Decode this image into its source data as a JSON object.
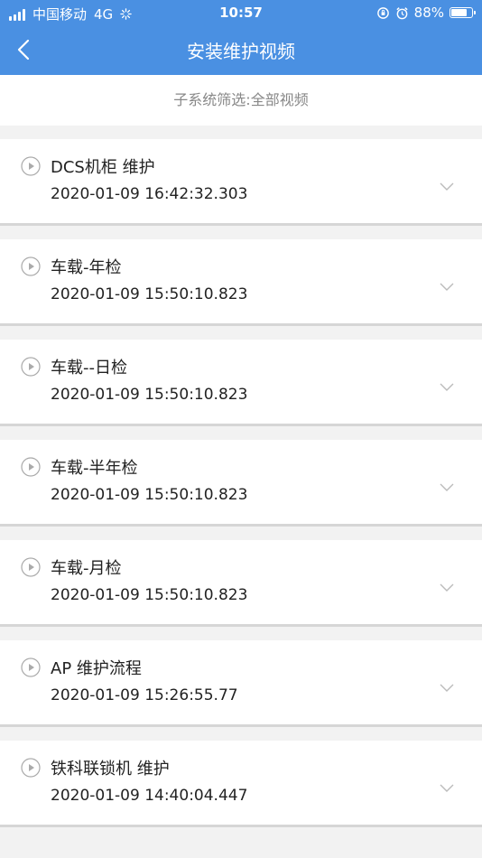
{
  "status": {
    "carrier": "中国移动",
    "network": "4G",
    "time": "10:57",
    "battery": "88%",
    "battery_level": 0.88
  },
  "header": {
    "title": "安装维护视频"
  },
  "filter": {
    "label": "子系统筛选:全部视频"
  },
  "videos": [
    {
      "name": "DCS机柜 维护",
      "date": "2020-01-09 16:42:32.303"
    },
    {
      "name": "车载-年检",
      "date": "2020-01-09 15:50:10.823"
    },
    {
      "name": "车载--日检",
      "date": "2020-01-09 15:50:10.823"
    },
    {
      "name": "车载-半年检",
      "date": "2020-01-09 15:50:10.823"
    },
    {
      "name": "车载-月检",
      "date": "2020-01-09 15:50:10.823"
    },
    {
      "name": "AP 维护流程",
      "date": "2020-01-09 15:26:55.77"
    },
    {
      "name": "铁科联锁机 维护",
      "date": "2020-01-09 14:40:04.447"
    }
  ],
  "colors": {
    "primary": "#4a90e2",
    "background": "#f2f2f2"
  }
}
